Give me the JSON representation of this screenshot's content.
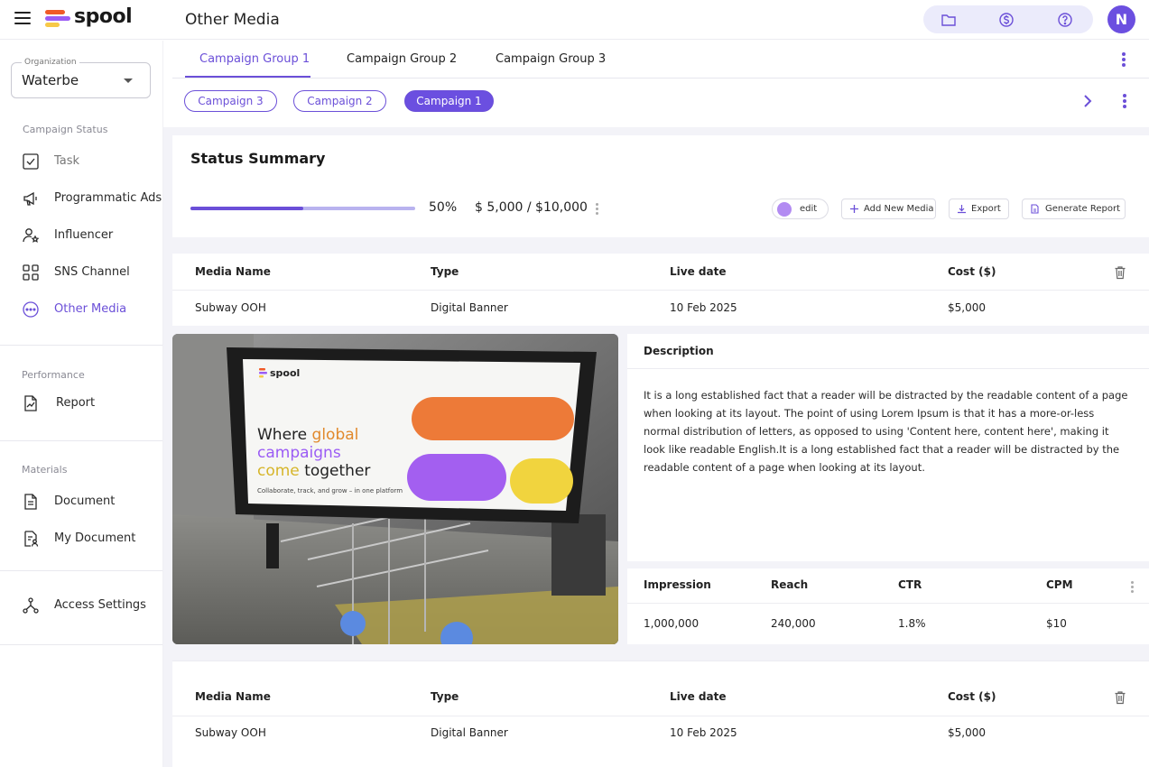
{
  "app": {
    "brand": "spool",
    "page_title": "Other Media",
    "avatar_initial": "N",
    "brand_colors": {
      "accent": "#6b4fd8",
      "logo_orange": "#f05a28",
      "logo_yellow": "#f7c948",
      "logo_purple": "#9b5cf5"
    }
  },
  "top_icons": [
    "folder-icon",
    "dollar-icon",
    "help-icon"
  ],
  "sidebar": {
    "org_label": "Organization",
    "org_value": "Waterbe",
    "sections": {
      "campaign_status": "Campaign Status",
      "performance": "Performance",
      "materials": "Materials"
    },
    "items": [
      {
        "label": "Task",
        "icon": "checkbox-icon"
      },
      {
        "label": "Programmatic Ads",
        "icon": "megaphone-icon"
      },
      {
        "label": "Influencer",
        "icon": "user-star-icon"
      },
      {
        "label": "SNS Channel",
        "icon": "grid-icon"
      },
      {
        "label": "Other Media",
        "icon": "more-circle-icon"
      },
      {
        "label": "Report",
        "icon": "chart-doc-icon"
      },
      {
        "label": "Document",
        "icon": "document-icon"
      },
      {
        "label": "My Document",
        "icon": "user-document-icon"
      },
      {
        "label": "Access Settings",
        "icon": "network-icon"
      }
    ]
  },
  "tabs": [
    "Campaign Group 1",
    "Campaign Group 2",
    "Campaign Group 3"
  ],
  "campaign_chips": [
    "Campaign 3",
    "Campaign 2",
    "Campaign 1"
  ],
  "summary": {
    "title": "Status Summary",
    "progress": 0.5,
    "percent_text": "50%",
    "budget_text": "$ 5,000 / $10,000",
    "edit_label": "edit",
    "add_label": "Add New Media",
    "export_label": "Export",
    "report_label": "Generate Report"
  },
  "media_table": {
    "headers": [
      "Media Name",
      "Type",
      "Live date",
      "Cost ($)"
    ],
    "rows": [
      {
        "name": "Subway OOH",
        "type": "Digital Banner",
        "date": "10 Feb 2025",
        "cost": "$5,000"
      }
    ]
  },
  "billboard": {
    "brand": "spool",
    "headline_1a": "Where",
    "headline_1b": "global",
    "headline_2": "campaigns",
    "headline_3a": "come",
    "headline_3b": "together",
    "tagline": "Collaborate, track, and grow – in one platform"
  },
  "description": {
    "title": "Description",
    "text": "It is a long established fact that a reader will be distracted by the readable content of a page when looking at its layout. The point of using Lorem Ipsum is that it has a more-or-less normal distribution of letters, as opposed to using 'Content here, content here', making it look like readable English.It is a long established fact that a reader will be distracted by the readable content of a page when looking at its layout."
  },
  "metrics": {
    "headers": [
      "Impression",
      "Reach",
      "CTR",
      "CPM"
    ],
    "values": [
      "1,000,000",
      "240,000",
      "1.8%",
      "$10"
    ]
  },
  "media_table_2": {
    "headers": [
      "Media Name",
      "Type",
      "Live date",
      "Cost ($)"
    ],
    "rows": [
      {
        "name": "Subway OOH",
        "type": "Digital Banner",
        "date": "10 Feb 2025",
        "cost": "$5,000"
      }
    ]
  }
}
